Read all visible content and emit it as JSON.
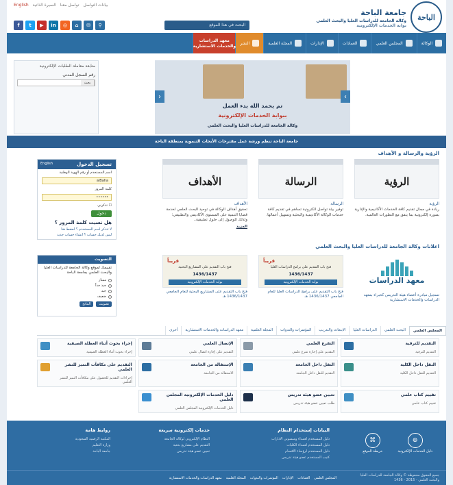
{
  "header": {
    "logo_text": "الباحة",
    "university_name": "جامعة الباحة",
    "agency_name": "وكالة الجامعة للدراسات العليا والبحث العلمي",
    "portal_name": "بوابة الخدمات الإلكترونية",
    "top_links": [
      "بيانات التواصل",
      "تواصل معنا",
      "السيرة الذاتية"
    ],
    "english_link": "English",
    "search_placeholder": "البحث في هذا الموقع"
  },
  "socials": [
    {
      "icon": "facebook-icon",
      "glyph": "f",
      "color": "#3b5998"
    },
    {
      "icon": "twitter-icon",
      "glyph": "t",
      "color": "#1da1f2"
    },
    {
      "icon": "youtube-icon",
      "glyph": "▶",
      "color": "#c4302b"
    },
    {
      "icon": "linkedin-icon",
      "glyph": "in",
      "color": "#0e76a8"
    },
    {
      "icon": "rss-icon",
      "glyph": "◎",
      "color": "#f26522"
    },
    {
      "icon": "sitemap-icon",
      "glyph": "⌂",
      "color": "#2c6ea3"
    },
    {
      "icon": "mail-icon",
      "glyph": "✉",
      "color": "#2c6ea3"
    },
    {
      "icon": "search-icon",
      "glyph": "⚲",
      "color": "#2c6ea3"
    }
  ],
  "nav": {
    "items": [
      "الوكالة",
      "المجلس العلمي",
      "العمادات",
      "الإدارات",
      "المجلة العلمية",
      "النشر"
    ],
    "special_line1": "معهد الدراسات",
    "special_line2": "والخدمات الاستشارية"
  },
  "slider": {
    "headline": "تم بحمد الله بدء العمل",
    "subheadline": "ببوابة الخدمات الإلكترونية",
    "footer": "وكالة الجامعة للدراسات العليا والبحث العلمي"
  },
  "tracking": {
    "title": "متابعة معاملة الطلبات الإلكترونية",
    "label": "رقم السجل المدني",
    "button": "بحث"
  },
  "ticker": "جامعة الباحة تنظم ورشة عمل مقترحات الأبحاث التنموية بمنطقة الباحة",
  "vision_section_title": "الرؤية والرسالة و الأهداف",
  "vision_cards": [
    {
      "image_text": "الرؤية",
      "title": "الرؤية",
      "desc": "ريادة في مجال تقديم كافة الخدمات الأكاديمية والإدارية بصورة إلكترونية بما يتفق مع التطورات العالمية."
    },
    {
      "image_text": "الرسالة",
      "title": "الرسالة",
      "desc": "توفير بيئة تواصل الكترونية تساهم في تقديم كافة خدمات الوكالة الأكاديمية والبحثية وتسهيل أعمالها."
    },
    {
      "image_text": "الأهداف",
      "title": "الأهداف",
      "desc": "تحقيق أهداف الوكالة في توحيد البحث العلمي لخدمة قضايا التنمية على المستوى الأكاديمي والتطبيقي؛ ولذلك للوصول إلى حلول تطبيقية..",
      "more": "المزيد"
    }
  ],
  "login": {
    "title": "تسجيل الدخول",
    "lang": "English",
    "user_label": "اسم المستخدم أو رقم الهوية الوطنية",
    "user_value": "alBaha",
    "password_label": "كلمة المرور",
    "password_value": "••••••",
    "remember": "تذكرني",
    "button": "دخول",
    "forgot_title": "هل نسيت كلمة المرور ؟",
    "forgot_link1": "لا تتذكر اسم المستخدم ؟ اضغط هنا",
    "forgot_link2": "ليس لديك حساب ؟ انشاء حساب جديد"
  },
  "ann_section_title": "اعلانات وكالة الجامعة للدراسات العليا والبحث العلمي",
  "announcements": [
    {
      "soon": "قريباً",
      "title": "فتح باب التقديم على برامج الدراسات العليا",
      "year": "1436/1437",
      "bar": "بوابة الخدمات الإلكترونية",
      "caption": "فتح باب التقديم على برامج الدراسات العليا للعام الجامعي 1436/1437 هـ"
    },
    {
      "soon": "قريباً",
      "title": "فتح باب التقديم على المشاريع البحثية",
      "year": "1436/1437",
      "bar": "بوابة الخدمات الإلكترونية",
      "caption": "فتح باب التقديم على المشاريع البحثية للعام الجامعي 1436/1437 هـ"
    }
  ],
  "dsr": {
    "title": "معهد الدراسات",
    "caption": "تسجيل مبادرة أعضاء هيئة التدريس كخبراء بمعهد الدراسات والخدمات الاستشارية"
  },
  "poll": {
    "title": "التصويت",
    "question": "تقييمك لموقع وكالة الجامعة للدراسات العليا والبحث العلمي بجامعة الباحة",
    "options": [
      "ممتاز",
      "جيد جداً",
      "جيد",
      "ضعيف"
    ],
    "vote": "تصويت",
    "results": "النتائج"
  },
  "tabs": [
    "المجلس العلمي",
    "البحث العلمي",
    "الدراسات العليا",
    "الابتعاث والتدريب",
    "المؤتمرات والندوات",
    "المجلة العلمية",
    "معهد الدراسات والخدمات الاستشارية",
    "أخرى"
  ],
  "services": [
    {
      "title": "التقديم للترقية",
      "desc": "التقديم للترقية",
      "color": "#2c6ea3"
    },
    {
      "title": "التفرغ العلمي",
      "desc": "التقديم على إجازة تفرغ علمي",
      "color": "#8a9aa8"
    },
    {
      "title": "الإتصال العلمي",
      "desc": "التقديم على إجازة اتصال علمي",
      "color": "#5d7b96"
    },
    {
      "title": "إجراء بحوث أثناء العطلة الصيفية",
      "desc": "إجراء بحوث أثناء العطلة الصيفية",
      "color": "#3f8fc4"
    },
    {
      "title": "النقل داخل الكلية",
      "desc": "التقديم للنقل داخل الكلية",
      "color": "#3a8f8a"
    },
    {
      "title": "النقل داخل الجامعة",
      "desc": "التقديم للنقل داخل الجامعة",
      "color": "#3a7fb3"
    },
    {
      "title": "الإستقالة من الجامعة",
      "desc": "الاستقالة من الجامعة",
      "color": "#2c6ea3"
    },
    {
      "title": "التقديم على مكافآت التميز للنشر العلمي",
      "desc": "إجراءات التقديم للحصول على مكافأت التميز للنشر العلمي",
      "color": "#e0a030"
    },
    {
      "title": "تقييم كتاب علمي",
      "desc": "تقييم كتاب علمي",
      "color": "#3f8fc4"
    },
    {
      "title": "تعيين عضو هيئة تدريس",
      "desc": "طلب تعيين عضو هيئة تدريس",
      "color": "#1c2f4a"
    },
    {
      "title": "دليل الخدمات الإلكترونية المجلس العلمي",
      "desc": "دليل الخدمات الإلكترونية المجلس العلمي",
      "color": "#3a8fd0"
    },
    {
      "title": "",
      "desc": "",
      "color": "#fafbfc"
    }
  ],
  "footer": {
    "guides_title": "البيانات إستخدام النظام",
    "guides": [
      "دليل المستخدم لعمداء ومنسوبي الادارات",
      "دليل المستخدم لعمداء الكليات",
      "دليل المستخدم لرؤساء الأقسام",
      "كتيب المستخدم عضو هيئة تدريس"
    ],
    "eservices_title": "خدمات إلكترونية سريعة",
    "eservices": [
      "النظام الإلكتروني لوكالة الجامعة",
      "التقديم على مشاريع بحثية",
      "تعيين عضو هيئة تدريس"
    ],
    "links_title": "روابط هامة",
    "links": [
      "المكتبة الرقمية السعودية",
      "وزارة التعليم",
      "جامعة الباحة"
    ],
    "icons": [
      {
        "name": "e-library-icon",
        "glyph": "⊕",
        "label": "دليل الخدمات الإلكترونية"
      },
      {
        "name": "sitemap-icon",
        "glyph": "⌘",
        "label": "خريطة الموقع"
      }
    ],
    "copyright": "جميع الحقوق محفوظة © وكالة الجامعة للدراسات العليا والبحث العلمي - 2015 - 1436",
    "bottom_links": [
      "المجلس العلمي",
      "العمادات",
      "الإدارات",
      "المؤتمرات والندوات",
      "المجلة العلمية",
      "معهد الدراسات والخدمات الاستشارية"
    ]
  },
  "colors": {
    "primary": "#2c6ea3",
    "dark": "#2c5f92",
    "accent": "#c8402c"
  }
}
